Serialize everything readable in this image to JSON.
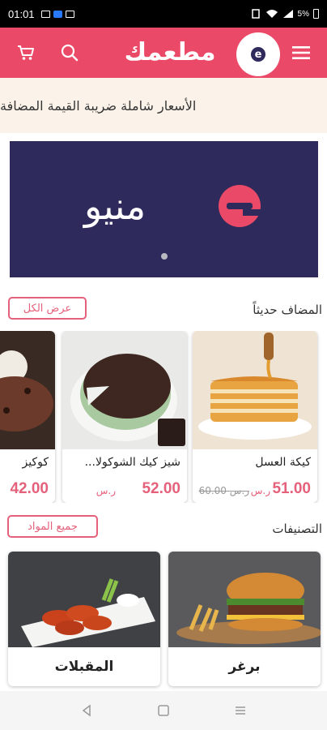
{
  "status_bar": {
    "time": "01:01",
    "battery": "5%"
  },
  "header": {
    "brand": "مطعمك",
    "logo_letter": "e",
    "icons": [
      "cart-icon",
      "search-icon",
      "menu-icon"
    ]
  },
  "vat_notice": "الأسعار شاملة ضريبة القيمة المضافة",
  "promo": {
    "word": "منيو"
  },
  "recently_added": {
    "title": "المضاف حديثاً",
    "view_all": "عرض الكل",
    "products": [
      {
        "name": "كيكة العسل",
        "price": "51.00",
        "currency": "ر.س",
        "old_price": "60.00 ر.س"
      },
      {
        "name": "شيز كيك الشوكولا...",
        "price": "52.00",
        "currency": "ر.س"
      },
      {
        "name": "كوكيز",
        "price": "42.00"
      }
    ]
  },
  "categories": {
    "title": "التصنيفات",
    "all_items": "جميع المواد",
    "items": [
      {
        "name": "برغر"
      },
      {
        "name": "المقبلات"
      }
    ]
  },
  "colors": {
    "primary": "#ea4a68",
    "brand_dark": "#2e2a5c",
    "notice_bg": "#fbf3ea",
    "price": "#e5607a"
  }
}
